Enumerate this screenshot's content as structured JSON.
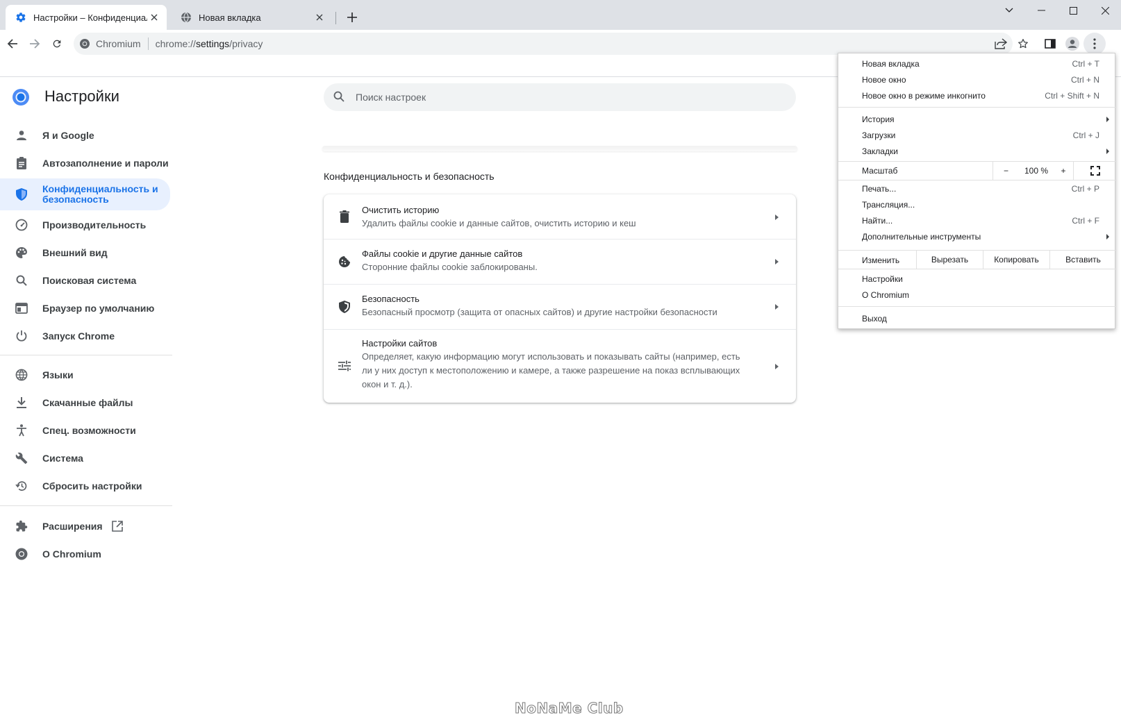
{
  "tabs": [
    {
      "title": "Настройки – Конфиденциально",
      "active": true
    },
    {
      "title": "Новая вкладка",
      "active": false
    }
  ],
  "window_controls": [
    "tab-search",
    "minimize",
    "maximize",
    "close"
  ],
  "omnibox": {
    "chip": "Chromium",
    "scheme": "chrome://",
    "host": "settings",
    "path": "/privacy"
  },
  "settings": {
    "title": "Настройки",
    "search_placeholder": "Поиск настроек",
    "nav_group1": [
      {
        "label": "Я и Google",
        "icon": "person-icon"
      },
      {
        "label": "Автозаполнение и пароли",
        "icon": "clipboard-icon"
      },
      {
        "label": "Конфиденциальность и безопасность",
        "icon": "shield-icon",
        "selected": true
      },
      {
        "label": "Производительность",
        "icon": "speedometer-icon"
      },
      {
        "label": "Внешний вид",
        "icon": "palette-icon"
      },
      {
        "label": "Поисковая система",
        "icon": "search-icon"
      },
      {
        "label": "Браузер по умолчанию",
        "icon": "browser-window-icon"
      },
      {
        "label": "Запуск Chrome",
        "icon": "power-icon"
      }
    ],
    "nav_group2": [
      {
        "label": "Языки",
        "icon": "globe-icon"
      },
      {
        "label": "Скачанные файлы",
        "icon": "download-icon"
      },
      {
        "label": "Спец. возможности",
        "icon": "accessibility-icon"
      },
      {
        "label": "Система",
        "icon": "wrench-icon"
      },
      {
        "label": "Сбросить настройки",
        "icon": "restore-icon"
      }
    ],
    "nav_group3": [
      {
        "label": "Расширения",
        "icon": "puzzle-icon"
      },
      {
        "label": "О Chromium",
        "icon": "chromium-icon"
      }
    ],
    "section_title": "Конфиденциальность и безопасность",
    "rows": [
      {
        "title": "Очистить историю",
        "desc": "Удалить файлы cookie и данные сайтов, очистить историю и кеш",
        "icon": "trash-icon"
      },
      {
        "title": "Файлы cookie и другие данные сайтов",
        "desc": "Сторонние файлы cookie заблокированы.",
        "icon": "cookie-icon"
      },
      {
        "title": "Безопасность",
        "desc": "Безопасный просмотр (защита от опасных сайтов) и другие настройки безопасности",
        "icon": "security-shield-icon"
      },
      {
        "title": "Настройки сайтов",
        "desc": "Определяет, какую информацию могут использовать и показывать сайты (например, есть ли у них доступ к местоположению и камере, а также разрешение на показ всплывающих окон и т. д.).",
        "icon": "tune-icon"
      }
    ]
  },
  "menu": {
    "new_tab": {
      "label": "Новая вкладка",
      "shortcut": "Ctrl + T"
    },
    "new_window": {
      "label": "Новое окно",
      "shortcut": "Ctrl + N"
    },
    "incognito": {
      "label": "Новое окно в режиме инкогнито",
      "shortcut": "Ctrl + Shift + N"
    },
    "history": {
      "label": "История"
    },
    "downloads": {
      "label": "Загрузки",
      "shortcut": "Ctrl + J"
    },
    "bookmarks": {
      "label": "Закладки"
    },
    "zoom": {
      "label": "Масштаб",
      "minus": "−",
      "value": "100 %",
      "plus": "+"
    },
    "print": {
      "label": "Печать...",
      "shortcut": "Ctrl + P"
    },
    "cast": {
      "label": "Трансляция..."
    },
    "find": {
      "label": "Найти...",
      "shortcut": "Ctrl + F"
    },
    "more_tools": {
      "label": "Дополнительные инструменты"
    },
    "edit": {
      "label": "Изменить",
      "cut": "Вырезать",
      "copy": "Копировать",
      "paste": "Вставить"
    },
    "settings": {
      "label": "Настройки"
    },
    "about": {
      "label": "О Chromium"
    },
    "exit": {
      "label": "Выход"
    }
  },
  "watermark": "NoNaMe Club"
}
